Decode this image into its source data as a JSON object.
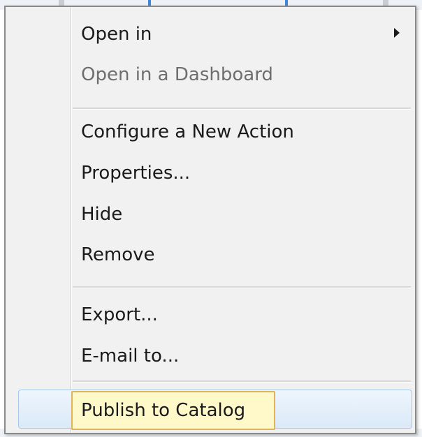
{
  "menu": {
    "items": [
      {
        "label": "Open in"
      },
      {
        "label": "Open in a Dashboard"
      },
      {
        "label": "Configure a New Action"
      },
      {
        "label": "Properties..."
      },
      {
        "label": "Hide"
      },
      {
        "label": "Remove"
      },
      {
        "label": "Export..."
      },
      {
        "label": "E-mail to..."
      },
      {
        "label": "Publish to Catalog"
      }
    ]
  },
  "colors": {
    "menu_bg": "#f1f1f1",
    "disabled_text": "#6e6e6e",
    "highlight_fill": "#fff9c9",
    "highlight_border": "#e2b45a",
    "hover_border": "#a8c8ea"
  }
}
